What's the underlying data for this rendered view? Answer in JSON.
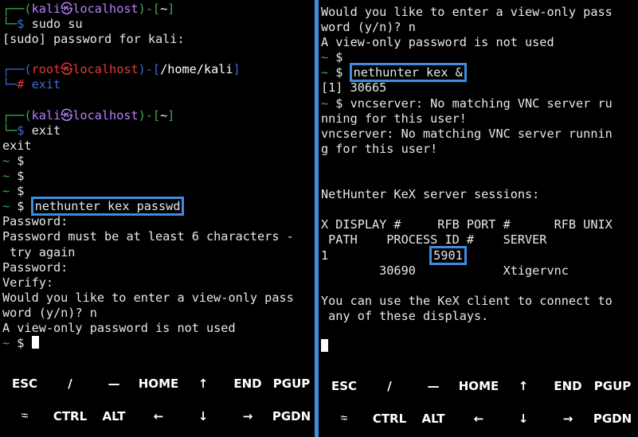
{
  "left": {
    "lines": [
      [
        {
          "t": "┌──(",
          "c": "green"
        },
        {
          "t": "kali㉿localhost",
          "c": "purple"
        },
        {
          "t": ")-[",
          "c": "green"
        },
        {
          "t": "~",
          "c": "white"
        },
        {
          "t": "]",
          "c": "green"
        }
      ],
      [
        {
          "t": "└─",
          "c": "green"
        },
        {
          "t": "$ ",
          "c": "blue"
        },
        {
          "t": "sudo su"
        }
      ],
      [
        {
          "t": "[sudo] password for kali:"
        }
      ],
      [],
      [
        {
          "t": "┌──(",
          "c": "blue"
        },
        {
          "t": "root㉿localhost",
          "c": "red"
        },
        {
          "t": ")-[",
          "c": "blue"
        },
        {
          "t": "/home/kali",
          "c": "white"
        },
        {
          "t": "]",
          "c": "blue"
        }
      ],
      [
        {
          "t": "└─",
          "c": "blue"
        },
        {
          "t": "# ",
          "c": "red"
        },
        {
          "t": "exit",
          "c": "blue"
        }
      ],
      [],
      [
        {
          "t": "┌──(",
          "c": "green"
        },
        {
          "t": "kali㉿localhost",
          "c": "purple"
        },
        {
          "t": ")-[",
          "c": "green"
        },
        {
          "t": "~",
          "c": "white"
        },
        {
          "t": "]",
          "c": "green"
        }
      ],
      [
        {
          "t": "└─",
          "c": "green"
        },
        {
          "t": "$ ",
          "c": "blue"
        },
        {
          "t": "exit"
        }
      ],
      [
        {
          "t": "exit"
        }
      ],
      [
        {
          "t": "~ ",
          "c": "green"
        },
        {
          "t": "$"
        }
      ],
      [
        {
          "t": "~ ",
          "c": "green"
        },
        {
          "t": "$"
        }
      ],
      [
        {
          "t": "~ ",
          "c": "green"
        },
        {
          "t": "$"
        }
      ],
      [
        {
          "t": "~ ",
          "c": "green"
        },
        {
          "t": "$ "
        },
        {
          "t": "nethunter kex passwd",
          "hl": true
        }
      ],
      [
        {
          "t": "Password:"
        }
      ],
      [
        {
          "t": "Password must be at least 6 characters -"
        }
      ],
      [
        {
          "t": " try again"
        }
      ],
      [
        {
          "t": "Password:"
        }
      ],
      [
        {
          "t": "Verify:"
        }
      ],
      [
        {
          "t": "Would you like to enter a view-only pass"
        }
      ],
      [
        {
          "t": "word (y/n)? n"
        }
      ],
      [
        {
          "t": "A view-only password is not used"
        }
      ],
      [
        {
          "t": "~ ",
          "c": "green"
        },
        {
          "t": "$ "
        },
        {
          "cursor": true
        }
      ]
    ],
    "keys_row1": [
      "ESC",
      "/",
      "—",
      "HOME",
      "↑",
      "END",
      "PGUP"
    ],
    "keys_row2": [
      "⭾",
      "CTRL",
      "ALT",
      "←",
      "↓",
      "→",
      "PGDN"
    ]
  },
  "right": {
    "lines": [
      [
        {
          "t": "Would you like to enter a view-only pass"
        }
      ],
      [
        {
          "t": "word (y/n)? n"
        }
      ],
      [
        {
          "t": "A view-only password is not used"
        }
      ],
      [
        {
          "t": "~ ",
          "c": "green"
        },
        {
          "t": "$"
        }
      ],
      [
        {
          "t": "~ ",
          "c": "green"
        },
        {
          "t": "$ "
        },
        {
          "t": "nethunter kex &",
          "hl": true
        }
      ],
      [
        {
          "t": "[1] 30665"
        }
      ],
      [
        {
          "t": "~ ",
          "c": "green"
        },
        {
          "t": "$ vncserver: No matching VNC server ru"
        }
      ],
      [
        {
          "t": "nning for this user!"
        }
      ],
      [
        {
          "t": "vncserver: No matching VNC server runnin"
        }
      ],
      [
        {
          "t": "g for this user!"
        }
      ],
      [],
      [],
      [
        {
          "t": "NetHunter KeX server sessions:"
        }
      ],
      [],
      [
        {
          "t": "X DISPLAY #     RFB PORT #      RFB UNIX"
        }
      ],
      [
        {
          "t": " PATH    PROCESS ID #    SERVER"
        }
      ],
      [
        {
          "t": "1              "
        },
        {
          "t": "5901",
          "hl": true
        }
      ],
      [
        {
          "t": "        30690            Xtigervnc"
        }
      ],
      [],
      [
        {
          "t": "You can use the KeX client to connect to"
        }
      ],
      [
        {
          "t": " any of these displays."
        }
      ],
      [],
      [
        {
          "cursor": true
        }
      ]
    ],
    "keys_row1": [
      "ESC",
      "/",
      "—",
      "HOME",
      "↑",
      "END",
      "PGUP"
    ],
    "keys_row2": [
      "⭾",
      "CTRL",
      "ALT",
      "←",
      "↓",
      "→",
      "PGDN"
    ]
  }
}
